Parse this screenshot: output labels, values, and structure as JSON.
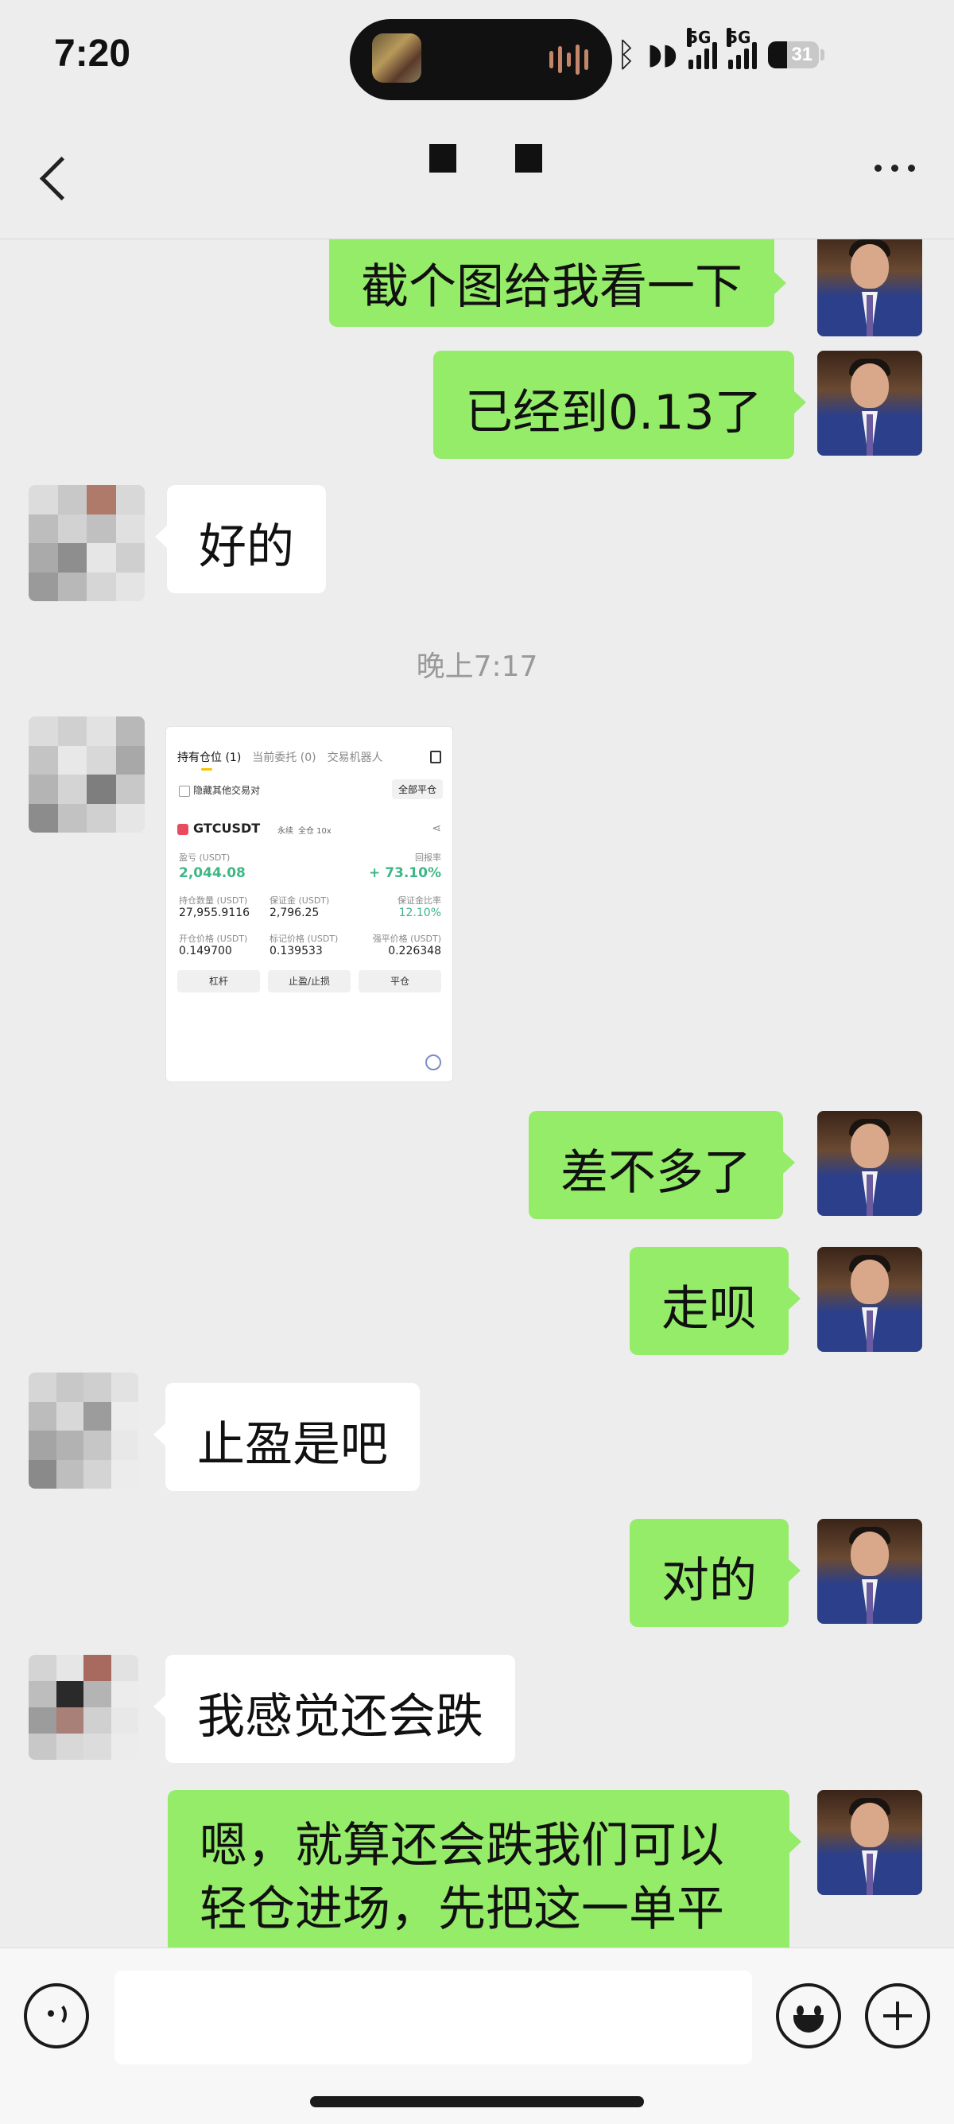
{
  "status_bar": {
    "time": "7:20",
    "network": "5G",
    "battery": "31"
  },
  "nav": {
    "back_label": "返回",
    "more_label": "更多"
  },
  "messages": [
    {
      "side": "right",
      "text": "截个图给我看一下"
    },
    {
      "side": "right",
      "text": "已经到0.13了"
    },
    {
      "side": "left",
      "text": "好的"
    },
    {
      "type": "timestamp",
      "text": "晚上7:17"
    },
    {
      "side": "left",
      "type": "image"
    },
    {
      "side": "right",
      "text": "差不多了"
    },
    {
      "side": "right",
      "text": "走呗"
    },
    {
      "side": "left",
      "text": "止盈是吧"
    },
    {
      "side": "right",
      "text": "对的"
    },
    {
      "side": "left",
      "text": "我感觉还会跌"
    },
    {
      "side": "right",
      "lines": [
        "嗯，就算还会跌我们可以",
        "轻仓进场，先把这一单平"
      ]
    }
  ],
  "screenshot": {
    "tabs": [
      "持有仓位 (1)",
      "当前委托 (0)",
      "交易机器人"
    ],
    "hide_others": "隐藏其他交易对",
    "close_all": "全部平仓",
    "symbol": "GTCUSDT",
    "tag_perp": "永续",
    "tag_cross": "全仓 10x",
    "pnl_label": "盈亏 (USDT)",
    "pnl_value": "2,044.08",
    "roe_label": "回报率",
    "roe_value": "+ 73.10%",
    "qty_label": "持仓数量 (USDT)",
    "qty_value": "27,955.9116",
    "margin_label": "保证金 (USDT)",
    "margin_value": "2,796.25",
    "margin_ratio_label": "保证金比率",
    "margin_ratio_value": "12.10%",
    "entry_label": "开仓价格 (USDT)",
    "entry_value": "0.149700",
    "mark_label": "标记价格 (USDT)",
    "mark_value": "0.139533",
    "liq_label": "强平价格 (USDT)",
    "liq_value": "0.226348",
    "btn_leverage": "杠杆",
    "btn_tpsl": "止盈/止损",
    "btn_close": "平仓"
  },
  "input": {
    "placeholder": ""
  },
  "colors": {
    "bubble_right": "#95ec69",
    "bubble_left": "#ffffff",
    "background": "#ededed"
  }
}
